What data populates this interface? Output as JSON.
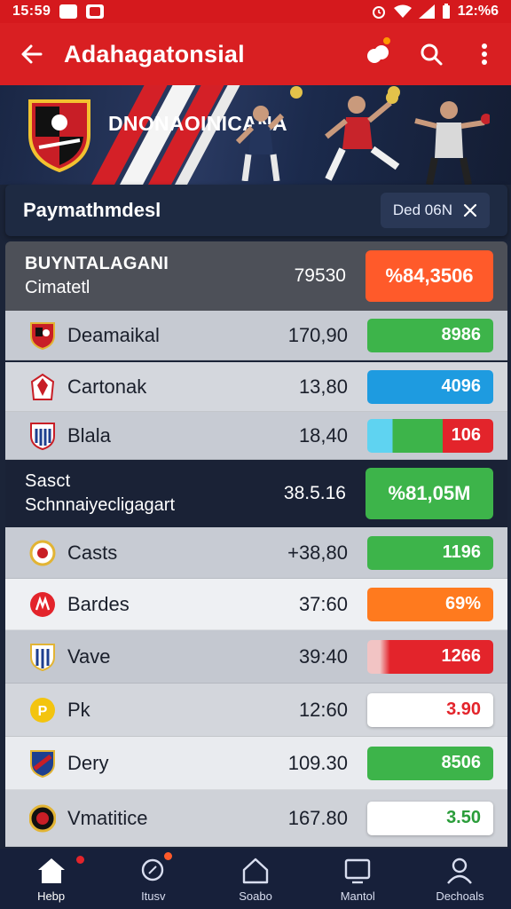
{
  "status_bar": {
    "time": "15:59",
    "right_time": "12:%6"
  },
  "app_bar": {
    "title": "Adahagatonsial"
  },
  "hero": {
    "title": "DNONAOINICANA"
  },
  "filter": {
    "title": "Paymathmdesl",
    "chip_label": "Ded 06N"
  },
  "section1": {
    "heading": "BUYNTALAGANI",
    "subheading": "Cimatetl",
    "amount": "79530",
    "pill": "%84,3506",
    "pill_color": "#ff5a2a"
  },
  "section1_rows": [
    {
      "name": "Deamaikal",
      "value": "170,90",
      "pill": "8986",
      "pill_type": "green"
    },
    {
      "name": "Cartonak",
      "value": "13,80",
      "pill": "4096",
      "pill_type": "blue"
    },
    {
      "name": "Blala",
      "value": "18,40",
      "pill": "106",
      "pill_type": "split"
    }
  ],
  "section2": {
    "heading": "Sasct",
    "subheading": "Schnnaiyecligagart",
    "amount": "38.5.16",
    "pill": "%81,05M",
    "pill_color": "#3db44a"
  },
  "section2_rows": [
    {
      "name": "Casts",
      "value": "+38,80",
      "pill": "1196",
      "pill_type": "green",
      "bg": "#c7cbd3"
    },
    {
      "name": "Bardes",
      "value": "37:60",
      "pill": "69%",
      "pill_type": "orange",
      "bg": "#eef0f3"
    },
    {
      "name": "Vave",
      "value": "39:40",
      "pill": "1266",
      "pill_type": "fadered",
      "bg": "#c4c8d0"
    },
    {
      "name": "Pk",
      "value": "12:60",
      "pill": "3.90",
      "pill_type": "white",
      "pill_text_color": "#e3242b",
      "bg": "#d3d6dc"
    },
    {
      "name": "Dery",
      "value": "109.30",
      "pill": "8506",
      "pill_type": "green",
      "bg": "#e9ebef"
    },
    {
      "name": "Vmatitice",
      "value": "167.80",
      "pill": "3.50",
      "pill_type": "white",
      "pill_text_color": "#2a9d3a",
      "bg": "#cfd2d8"
    }
  ],
  "bottom_nav": [
    {
      "label": "Hebp",
      "icon": "home-icon"
    },
    {
      "label": "Itusv",
      "icon": "search-icon"
    },
    {
      "label": "Soabo",
      "icon": "house-icon"
    },
    {
      "label": "Mantol",
      "icon": "monitor-icon"
    },
    {
      "label": "Dechoals",
      "icon": "user-icon"
    }
  ]
}
